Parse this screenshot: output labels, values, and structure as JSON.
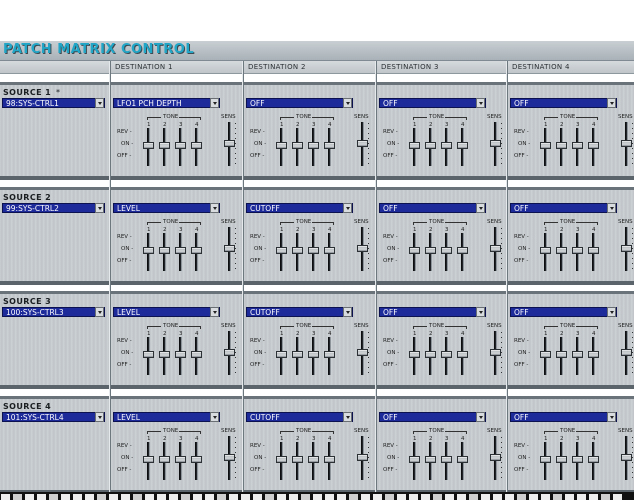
{
  "title": "PATCH MATRIX CONTROL",
  "destinations": [
    "DESTINATION 1",
    "DESTINATION 2",
    "DESTINATION 3",
    "DESTINATION 4"
  ],
  "labels": {
    "tone": "TONE",
    "sens": "SENS",
    "tone_numbers": [
      "1",
      "2",
      "3",
      "4"
    ],
    "rev": "REV -",
    "on": "ON -",
    "off": "OFF -",
    "source_marker": "*"
  },
  "sources": [
    {
      "label": "SOURCE 1",
      "value": "98:SYS-CTRL1",
      "dests": [
        "LFO1 PCH DEPTH",
        "OFF",
        "OFF",
        "OFF"
      ]
    },
    {
      "label": "SOURCE 2",
      "value": "99:SYS-CTRL2",
      "dests": [
        "LEVEL",
        "CUTOFF",
        "OFF",
        "OFF"
      ]
    },
    {
      "label": "SOURCE 3",
      "value": "100:SYS-CTRL3",
      "dests": [
        "LEVEL",
        "CUTOFF",
        "OFF",
        "OFF"
      ]
    },
    {
      "label": "SOURCE 4",
      "value": "101:SYS-CTRL4",
      "dests": [
        "LEVEL",
        "CUTOFF",
        "OFF",
        "OFF"
      ]
    }
  ],
  "colors": {
    "title": "#21a6c7",
    "select_bg": "#1d2a9a"
  }
}
